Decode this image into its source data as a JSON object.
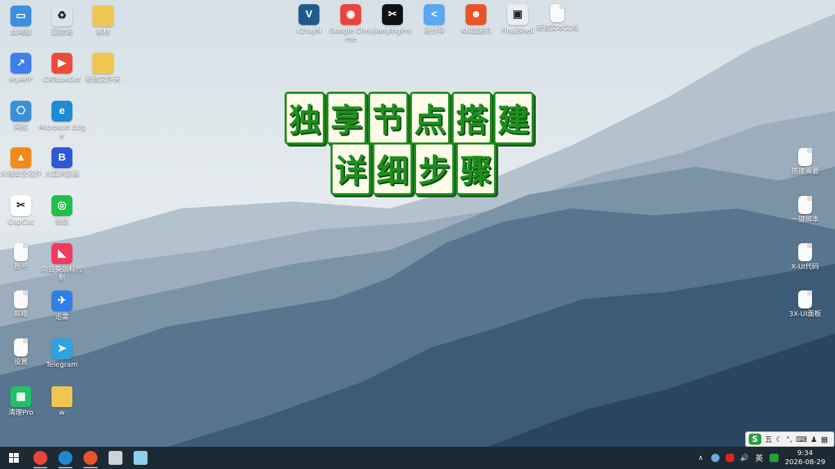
{
  "desktop": {
    "icons": [
      {
        "id": "this-pc",
        "label": "此电脑",
        "color": "#3d8ee0",
        "glyph": "▭"
      },
      {
        "id": "recycle-bin",
        "label": "回收站",
        "color": "#d7e3ee",
        "glyph": "♻"
      },
      {
        "id": "folder-1",
        "label": "素材",
        "color": "#f0c652",
        "glyph": ""
      },
      {
        "id": "myapp",
        "label": "MyAPP",
        "color": "#3f80e8",
        "glyph": "↗"
      },
      {
        "id": "crtubeget",
        "label": "CRTubeGet",
        "color": "#f04b3a",
        "glyph": "▶"
      },
      {
        "id": "new-folder",
        "label": "新建文件夹",
        "color": "#f0c652",
        "glyph": ""
      },
      {
        "id": "network",
        "label": "网络",
        "color": "#3b8fd6",
        "glyph": "⎔"
      },
      {
        "id": "edge",
        "label": "Microsoft Edge",
        "color": "#1f8ad1",
        "glyph": "e"
      },
      {
        "id": "huorong",
        "label": "火绒安全软件",
        "color": "#f28a1a",
        "glyph": "▲"
      },
      {
        "id": "security-browser",
        "label": "火狐浏览器",
        "color": "#2e58d6",
        "glyph": "B"
      },
      {
        "id": "capcut",
        "label": "CapCut",
        "color": "#ffffff",
        "glyph": "✂"
      },
      {
        "id": "wechat",
        "label": "微信",
        "color": "#1fbf4a",
        "glyph": "◎"
      },
      {
        "id": "doc-1",
        "label": "账号",
        "color": "#fafafa",
        "glyph": ""
      },
      {
        "id": "sunlogin",
        "label": "向日葵远程控制",
        "color": "#f23a5c",
        "glyph": "◣"
      },
      {
        "id": "doc-2",
        "label": "邮箱",
        "color": "#fafafa",
        "glyph": ""
      },
      {
        "id": "feishu",
        "label": "迅雷",
        "color": "#2f7fe6",
        "glyph": "✈"
      },
      {
        "id": "doc-3",
        "label": "设置",
        "color": "#fafafa",
        "glyph": ""
      },
      {
        "id": "telegram",
        "label": "Telegram",
        "color": "#2fa3e0",
        "glyph": "➤"
      },
      {
        "id": "cleanpro",
        "label": "清理Pro",
        "color": "#22c06a",
        "glyph": "▦"
      },
      {
        "id": "w-file",
        "label": "w",
        "color": "#f0c652",
        "glyph": ""
      },
      {
        "id": "v2rayn",
        "label": "v2rayN",
        "color": "#1e5a8c",
        "glyph": "V"
      },
      {
        "id": "chrome",
        "label": "Google Chrome",
        "color": "#e8453c",
        "glyph": "◉"
      },
      {
        "id": "jianying",
        "label": "JianyingPro",
        "color": "#111111",
        "glyph": "✂"
      },
      {
        "id": "share",
        "label": "易分享",
        "color": "#5aa8f0",
        "glyph": "<"
      },
      {
        "id": "kk",
        "label": "KK加速机",
        "color": "#e8552a",
        "glyph": "☻"
      },
      {
        "id": "finalshell",
        "label": "FinalShell",
        "color": "#e8eef3",
        "glyph": "▣"
      },
      {
        "id": "new-text",
        "label": "新建文本文档",
        "color": "#fafafa",
        "glyph": ""
      },
      {
        "id": "doc-r1",
        "label": "搭建需要",
        "color": "#fafafa",
        "glyph": ""
      },
      {
        "id": "doc-r2",
        "label": "一键脚本",
        "color": "#fafafa",
        "glyph": ""
      },
      {
        "id": "doc-r3",
        "label": "X-UI代码",
        "color": "#fafafa",
        "glyph": ""
      },
      {
        "id": "doc-r4",
        "label": "3X-UI面板",
        "color": "#fafafa",
        "glyph": ""
      }
    ]
  },
  "overlay": {
    "line1": [
      "独",
      "享",
      "节",
      "点",
      "搭",
      "建"
    ],
    "line2": [
      "详",
      "细",
      "步",
      "骤"
    ]
  },
  "ime": {
    "logo": "S",
    "mode": "五",
    "items": [
      "☾",
      "°,",
      "⌨",
      "♟",
      "▦"
    ]
  },
  "taskbar": {
    "start_label": "Start",
    "apps": [
      {
        "id": "chrome",
        "color": "#e8453c",
        "active": true
      },
      {
        "id": "edge",
        "color": "#1f8ad1",
        "active": true
      },
      {
        "id": "kk",
        "color": "#e8552a",
        "active": true
      },
      {
        "id": "finalshell",
        "color": "#c9d3da",
        "active": false
      },
      {
        "id": "notepad",
        "color": "#8fd0e8",
        "active": false
      }
    ],
    "tray": {
      "chevron": "∧",
      "lang": "英",
      "time": "9:34",
      "date": "2026-08-29",
      "sound": "🔊"
    }
  }
}
